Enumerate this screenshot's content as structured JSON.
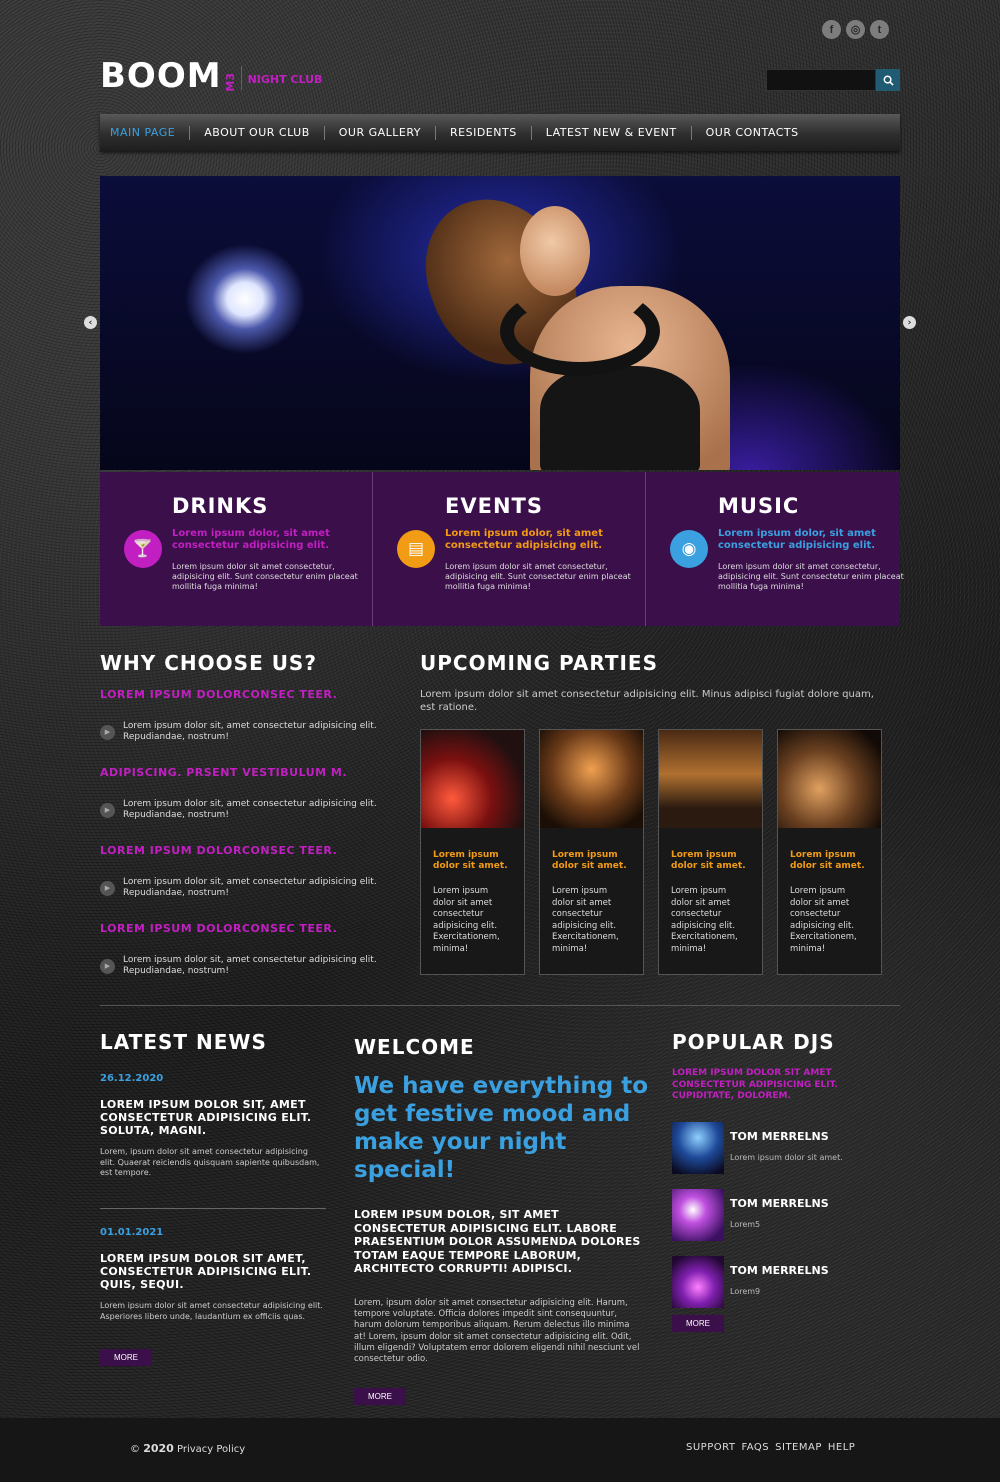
{
  "social": [
    "f",
    "◎",
    "t"
  ],
  "logo": {
    "main": "BOOM",
    "m3": "M3",
    "sub": "NIGHT CLUB"
  },
  "search": {
    "value": "",
    "placeholder": ""
  },
  "nav": [
    "MAIN PAGE",
    "ABOUT OUR CLUB",
    "OUR GALLERY",
    "RESIDENTS",
    "LATEST NEW & EVENT",
    "OUR CONTACTS"
  ],
  "features": [
    {
      "title": "DRINKS",
      "icon": "cocktail-icon",
      "glyph": "🍸",
      "color": "#c21fc2",
      "lead": "Lorem ipsum dolor, sit amet consectetur adipisicing elit.",
      "text": "Lorem ipsum dolor sit amet consectetur, adipisicing elit. Sunt consectetur enim placeat mollitia fuga minima!"
    },
    {
      "title": "EVENTS",
      "icon": "calendar-icon",
      "glyph": "▤",
      "color": "#f29b15",
      "lead": "Lorem ipsum dolor, sit amet consectetur adipisicing elit.",
      "text": "Lorem ipsum dolor sit amet consectetur, adipisicing elit. Sunt consectetur enim placeat mollitia fuga minima!"
    },
    {
      "title": "MUSIC",
      "icon": "disc-icon",
      "glyph": "◉",
      "color": "#3aa0e0",
      "lead": "Lorem ipsum dolor, sit amet consectetur adipisicing elit.",
      "text": "Lorem ipsum dolor sit amet consectetur, adipisicing elit. Sunt consectetur enim placeat mollitia fuga minima!"
    }
  ],
  "why": {
    "title": "WHY CHOOSE US?",
    "items": [
      {
        "head": "LOREM IPSUM DOLORCONSEC TEER.",
        "text": "Lorem ipsum dolor sit, amet consectetur adipisicing elit. Repudiandae, nostrum!"
      },
      {
        "head": "ADIPISCING. PRSENT VESTIBULUM M.",
        "text": "Lorem ipsum dolor sit, amet consectetur adipisicing elit. Repudiandae, nostrum!"
      },
      {
        "head": "LOREM IPSUM DOLORCONSEC TEER.",
        "text": "Lorem ipsum dolor sit, amet consectetur adipisicing elit. Repudiandae, nostrum!"
      },
      {
        "head": "LOREM IPSUM DOLORCONSEC TEER.",
        "text": "Lorem ipsum dolor sit, amet consectetur adipisicing elit. Repudiandae, nostrum!"
      }
    ]
  },
  "upcoming": {
    "title": "UPCOMING PARTIES",
    "desc": "Lorem ipsum dolor sit amet consectetur adipisicing elit. Minus adipisci fugiat dolore quam, est ratione.",
    "cards": [
      {
        "title": "Lorem ipsum dolor sit amet.",
        "text": "Lorem ipsum dolor sit amet consectetur adipisicing elit. Exercitationem, minima!"
      },
      {
        "title": "Lorem ipsum dolor sit amet.",
        "text": "Lorem ipsum dolor sit amet consectetur adipisicing elit. Exercitationem, minima!"
      },
      {
        "title": "Lorem ipsum dolor sit amet.",
        "text": "Lorem ipsum dolor sit amet consectetur adipisicing elit. Exercitationem, minima!"
      },
      {
        "title": "Lorem ipsum dolor sit amet.",
        "text": "Lorem ipsum dolor sit amet consectetur adipisicing elit. Exercitationem, minima!"
      }
    ]
  },
  "news": {
    "title": "LATEST NEWS",
    "items": [
      {
        "date": "26.12.2020",
        "head": "LOREM IPSUM DOLOR SIT, AMET CONSECTETUR ADIPISICING ELIT. SOLUTA, MAGNI.",
        "text": "Lorem, ipsum dolor sit amet consectetur adipisicing elit. Quaerat reiciendis quisquam sapiente quibusdam, est tempore."
      },
      {
        "date": "01.01.2021",
        "head": "LOREM IPSUM DOLOR SIT AMET, CONSECTETUR ADIPISICING ELIT. QUIS, SEQUI.",
        "text": "Lorem ipsum dolor sit amet consectetur adipisicing elit. Asperiores libero unde, laudantium ex officiis quas."
      }
    ],
    "more": "MORE"
  },
  "welcome": {
    "title": "WELCOME",
    "big": "We have everything to get festive mood and make your night special!",
    "caps": "LOREM IPSUM DOLOR, SIT AMET CONSECTETUR ADIPISICING ELIT. LABORE PRAESENTIUM DOLOR ASSUMENDA DOLORES TOTAM EAQUE TEMPORE LABORUM, ARCHITECTO CORRUPTI! ADIPISCI.",
    "text": "Lorem, ipsum dolor sit amet consectetur adipisicing elit. Harum, tempore voluptate. Officia dolores impedit sint consequuntur, harum dolorum temporibus aliquam. Rerum delectus illo minima at! Lorem, ipsum dolor sit amet consectetur adipisicing elit. Odit, illum eligendi? Voluptatem error dolorem eligendi nihil nesciunt vel consectetur odio.",
    "more": "MORE"
  },
  "djs": {
    "title": "POPULAR DJS",
    "lead": "LOREM IPSUM DOLOR SIT AMET CONSECTETUR ADIPISICING ELIT. CUPIDITATE, DOLOREM.",
    "items": [
      {
        "name": "TOM MERRELNS",
        "sub": "Lorem ipsum dolor sit amet."
      },
      {
        "name": "TOM MERRELNS",
        "sub": "Lorem5"
      },
      {
        "name": "TOM MERRELNS",
        "sub": "Lorem9"
      }
    ],
    "more": "MORE"
  },
  "footer": {
    "copy": "©",
    "year": "2020",
    "policy": "Privacy Policy",
    "links": [
      "SUPPORT",
      "FAQS",
      "SITEMAP",
      "HELP"
    ]
  }
}
